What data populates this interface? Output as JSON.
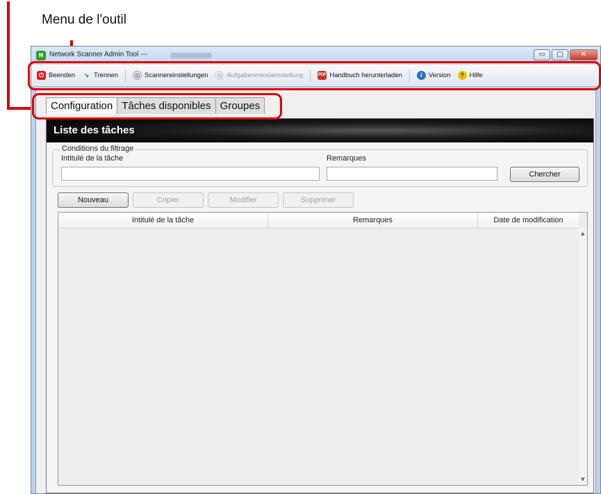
{
  "callout": {
    "label": "Menu de l'outil"
  },
  "window": {
    "title": "Network Scanner Admin Tool ---",
    "controls": {
      "minimize": "▭",
      "maximize": "□",
      "close": "✕"
    }
  },
  "toolbar": {
    "items": [
      {
        "label": "Beenden",
        "icon": "power-icon",
        "enabled": true
      },
      {
        "label": "Trennen",
        "icon": "disconnect-icon",
        "enabled": true
      },
      {
        "label": "Scannereinstellungen",
        "icon": "scanner-settings-icon",
        "enabled": true
      },
      {
        "label": "Aufgabenmenüeinstellung",
        "icon": "task-menu-settings-icon",
        "enabled": false
      },
      {
        "label": "Handbuch herunterladen",
        "icon": "pdf-icon",
        "enabled": true
      },
      {
        "label": "Version",
        "icon": "info-icon",
        "enabled": true
      },
      {
        "label": "Hilfe",
        "icon": "help-icon",
        "enabled": true
      }
    ]
  },
  "tabs": [
    {
      "label": "Configuration",
      "active": true
    },
    {
      "label": "Tâches disponibles",
      "active": false
    },
    {
      "label": "Groupes",
      "active": false
    }
  ],
  "panel": {
    "title": "Liste des tâches",
    "filter": {
      "legend": "Conditions du filtrage",
      "name_label": "Intitulé de la tâche",
      "name_value": "",
      "remarks_label": "Remarques",
      "remarks_value": "",
      "search_button": "Chercher"
    },
    "actions": {
      "new": "Nouveau",
      "copy": "Copier",
      "modify": "Modifier",
      "delete": "Supprimer"
    },
    "table": {
      "columns": [
        "Intitulé de la tâche",
        "Remarques",
        "Date de modification"
      ],
      "rows": []
    }
  },
  "colors": {
    "highlight": "#e10000",
    "header_bg": "#000000"
  }
}
